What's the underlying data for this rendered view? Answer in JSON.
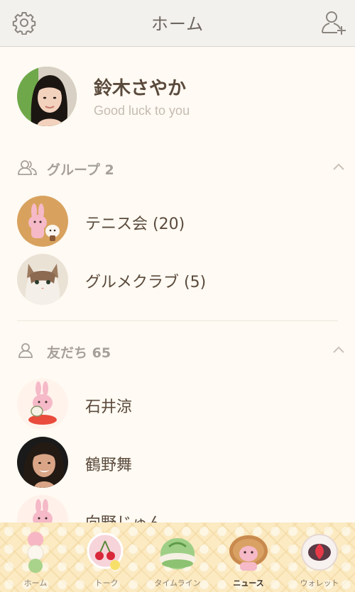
{
  "header": {
    "title": "ホーム",
    "settings_icon": "gear-icon",
    "add_friend_icon": "add-friend-icon"
  },
  "profile": {
    "name": "鈴木さやか",
    "status": "Good luck to you"
  },
  "groups": {
    "label": "グループ 2",
    "items": [
      {
        "name": "テニス会 (20)"
      },
      {
        "name": "グルメクラブ (5)"
      }
    ]
  },
  "friends": {
    "label": "友だち 65",
    "items": [
      {
        "name": "石井涼"
      },
      {
        "name": "鶴野舞"
      },
      {
        "name": "向野じゅん"
      }
    ]
  },
  "tabs": [
    {
      "label": "ホーム",
      "icon": "dango-icon"
    },
    {
      "label": "トーク",
      "icon": "cherry-icon"
    },
    {
      "label": "タイムライン",
      "icon": "mochi-icon"
    },
    {
      "label": "ニュース",
      "icon": "taiyaki-icon",
      "active": true
    },
    {
      "label": "ウォレット",
      "icon": "daifuku-icon"
    }
  ],
  "colors": {
    "background": "#fffaf3",
    "header": "#f3f1ee",
    "tabbar": "#fbeac2",
    "text": "#5a4a3c",
    "muted": "#a7a09a"
  }
}
